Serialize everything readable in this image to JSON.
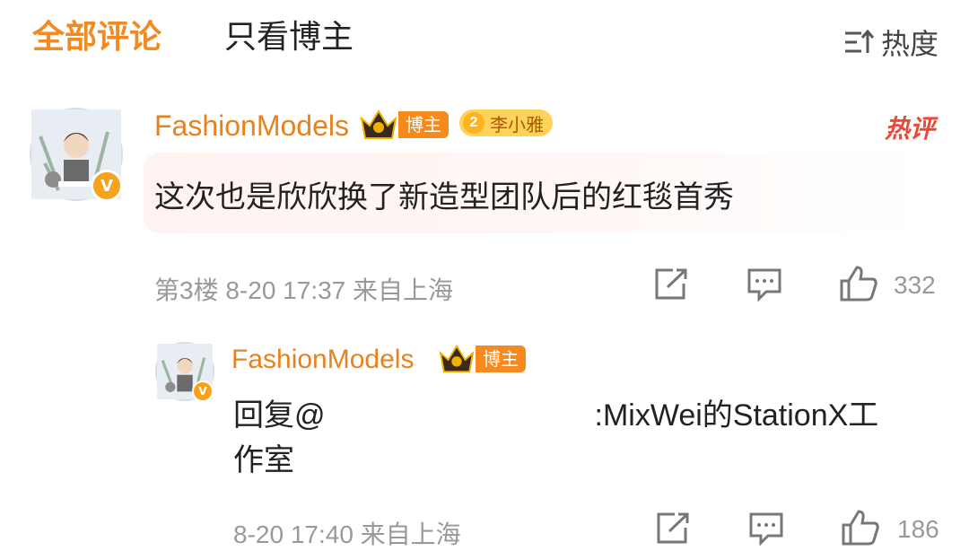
{
  "tabs": {
    "all": "全部评论",
    "blogger_only": "只看博主"
  },
  "sort": {
    "label": "热度",
    "icon": "sort-icon"
  },
  "comment": {
    "username": "FashionModels",
    "role_tag": "博主",
    "fan_badge": {
      "level": "2",
      "name": "李小雅"
    },
    "hot_tag": "热评",
    "text": "这次也是欣欣换了新造型团队后的红毯首秀",
    "floor": "第3楼",
    "time": "8-20 17:37",
    "location": "来自上海",
    "likes": "332"
  },
  "reply": {
    "username": "FashionModels",
    "role_tag": "博主",
    "prefix": "回复@",
    "suffix": ":MixWei的StationX工",
    "line2": "作室",
    "time": "8-20 17:40",
    "location": "来自上海",
    "likes": "186"
  },
  "colors": {
    "accent": "#f28a22",
    "username": "#e6821f",
    "hot": "#e84a3a",
    "meta": "#999999"
  }
}
